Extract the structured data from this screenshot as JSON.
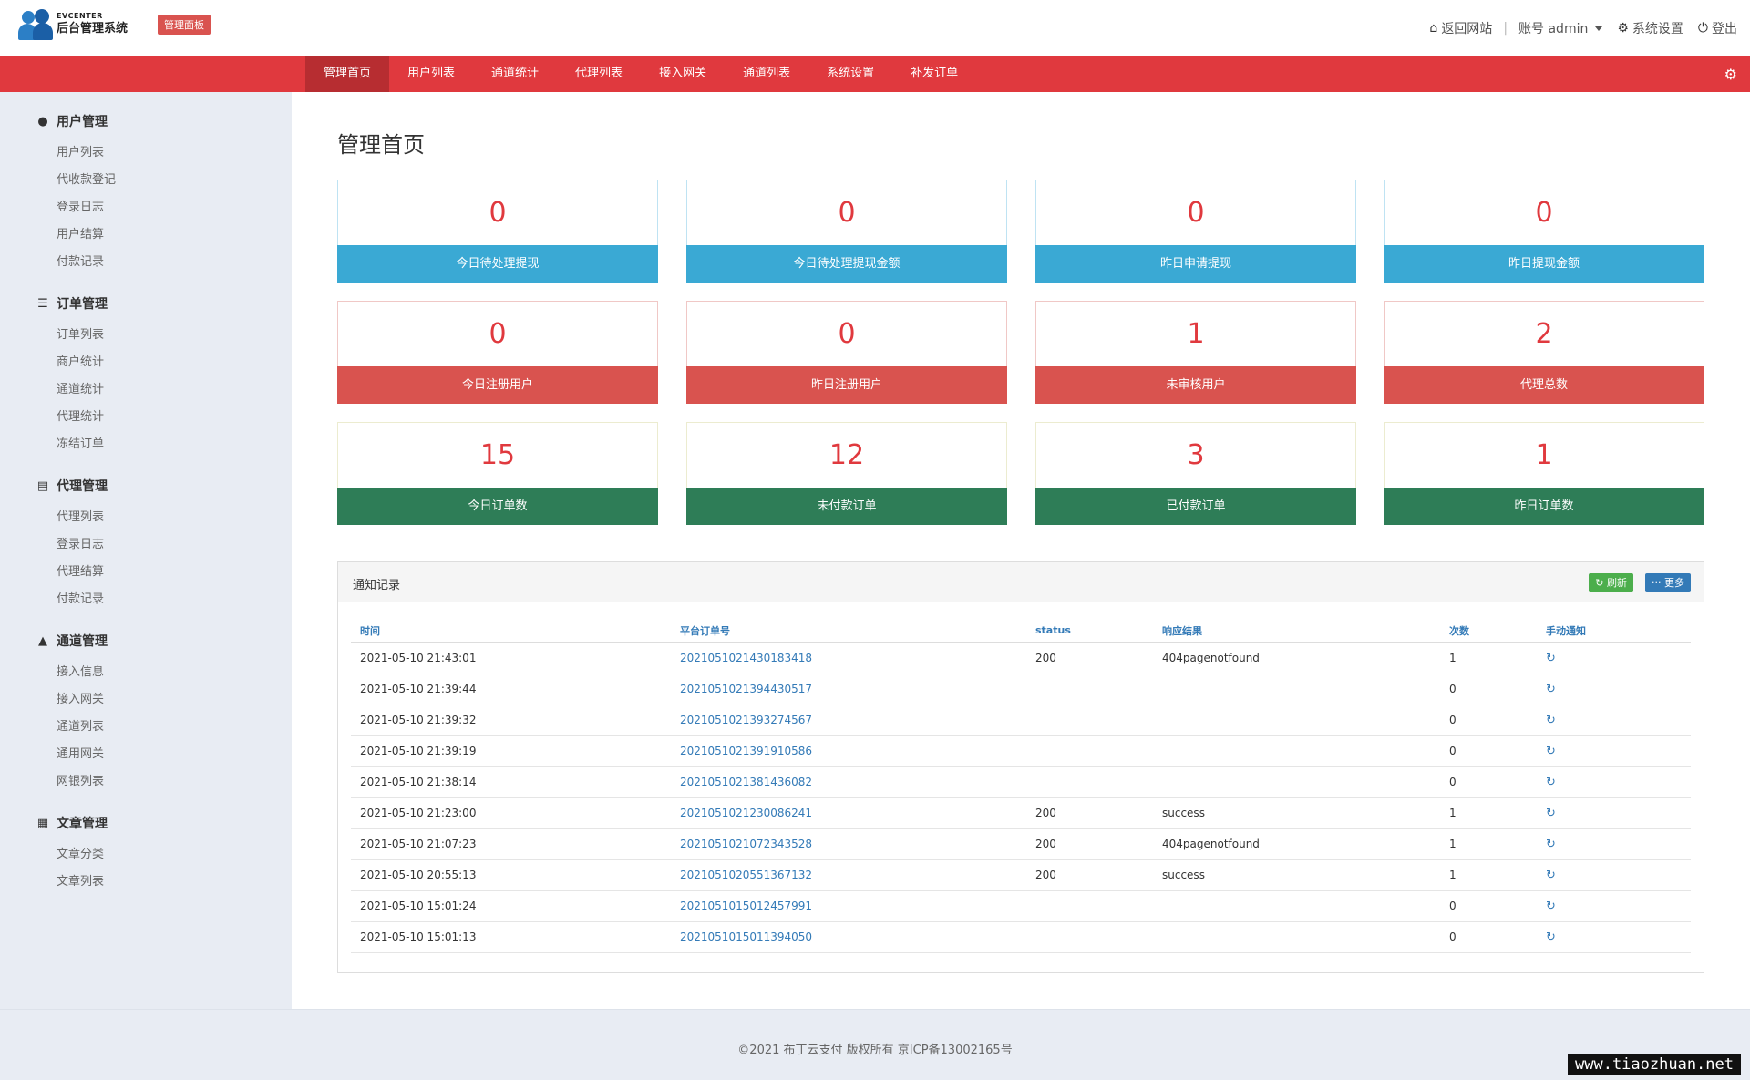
{
  "header": {
    "logo_en": "EVCENTER",
    "logo_cn": "后台管理系统",
    "badge": "管理面板",
    "back_site": "返回网站",
    "account": "账号 admin",
    "settings": "系统设置",
    "logout": "登出"
  },
  "topnav": {
    "items": [
      "管理首页",
      "用户列表",
      "通道统计",
      "代理列表",
      "接入网关",
      "通道列表",
      "系统设置",
      "补发订单"
    ]
  },
  "sidebar": {
    "groups": [
      {
        "title": "用户管理",
        "icon": "user-icon",
        "items": [
          "用户列表",
          "代收款登记",
          "登录日志",
          "用户结算",
          "付款记录"
        ]
      },
      {
        "title": "订单管理",
        "icon": "list-icon",
        "items": [
          "订单列表",
          "商户统计",
          "通道统计",
          "代理统计",
          "冻结订单"
        ]
      },
      {
        "title": "代理管理",
        "icon": "file-icon",
        "items": [
          "代理列表",
          "登录日志",
          "代理结算",
          "付款记录"
        ]
      },
      {
        "title": "通道管理",
        "icon": "road-icon",
        "items": [
          "接入信息",
          "接入网关",
          "通道列表",
          "通用网关",
          "网银列表"
        ]
      },
      {
        "title": "文章管理",
        "icon": "article-icon",
        "items": [
          "文章分类",
          "文章列表"
        ]
      }
    ]
  },
  "main": {
    "title": "管理首页",
    "cards": [
      {
        "value": "0",
        "label": "今日待处理提现",
        "color": "blue"
      },
      {
        "value": "0",
        "label": "今日待处理提现金额",
        "color": "blue"
      },
      {
        "value": "0",
        "label": "昨日申请提现",
        "color": "blue"
      },
      {
        "value": "0",
        "label": "昨日提现金额",
        "color": "blue"
      },
      {
        "value": "0",
        "label": "今日注册用户",
        "color": "red"
      },
      {
        "value": "0",
        "label": "昨日注册用户",
        "color": "red"
      },
      {
        "value": "1",
        "label": "未审核用户",
        "color": "red"
      },
      {
        "value": "2",
        "label": "代理总数",
        "color": "red"
      },
      {
        "value": "15",
        "label": "今日订单数",
        "color": "green"
      },
      {
        "value": "12",
        "label": "未付款订单",
        "color": "green"
      },
      {
        "value": "3",
        "label": "已付款订单",
        "color": "green"
      },
      {
        "value": "1",
        "label": "昨日订单数",
        "color": "green"
      }
    ],
    "panel": {
      "title": "通知记录",
      "refresh": "刷新",
      "more": "更多",
      "columns": [
        "时间",
        "平台订单号",
        "status",
        "响应结果",
        "次数",
        "手动通知"
      ],
      "rows": [
        [
          "2021-05-10 21:43:01",
          "2021051021430183418",
          "200",
          "404pagenotfound",
          "1"
        ],
        [
          "2021-05-10 21:39:44",
          "2021051021394430517",
          "",
          "",
          "0"
        ],
        [
          "2021-05-10 21:39:32",
          "2021051021393274567",
          "",
          "",
          "0"
        ],
        [
          "2021-05-10 21:39:19",
          "2021051021391910586",
          "",
          "",
          "0"
        ],
        [
          "2021-05-10 21:38:14",
          "2021051021381436082",
          "",
          "",
          "0"
        ],
        [
          "2021-05-10 21:23:00",
          "2021051021230086241",
          "200",
          "success",
          "1"
        ],
        [
          "2021-05-10 21:07:23",
          "2021051021072343528",
          "200",
          "404pagenotfound",
          "1"
        ],
        [
          "2021-05-10 20:55:13",
          "2021051020551367132",
          "200",
          "success",
          "1"
        ],
        [
          "2021-05-10 15:01:24",
          "2021051015012457991",
          "",
          "",
          "0"
        ],
        [
          "2021-05-10 15:01:13",
          "2021051015011394050",
          "",
          "",
          "0"
        ]
      ]
    }
  },
  "footer": {
    "text": "©2021 布丁云支付 版权所有 京ICP备13002165号",
    "watermark": "www.tiaozhuan.net"
  }
}
